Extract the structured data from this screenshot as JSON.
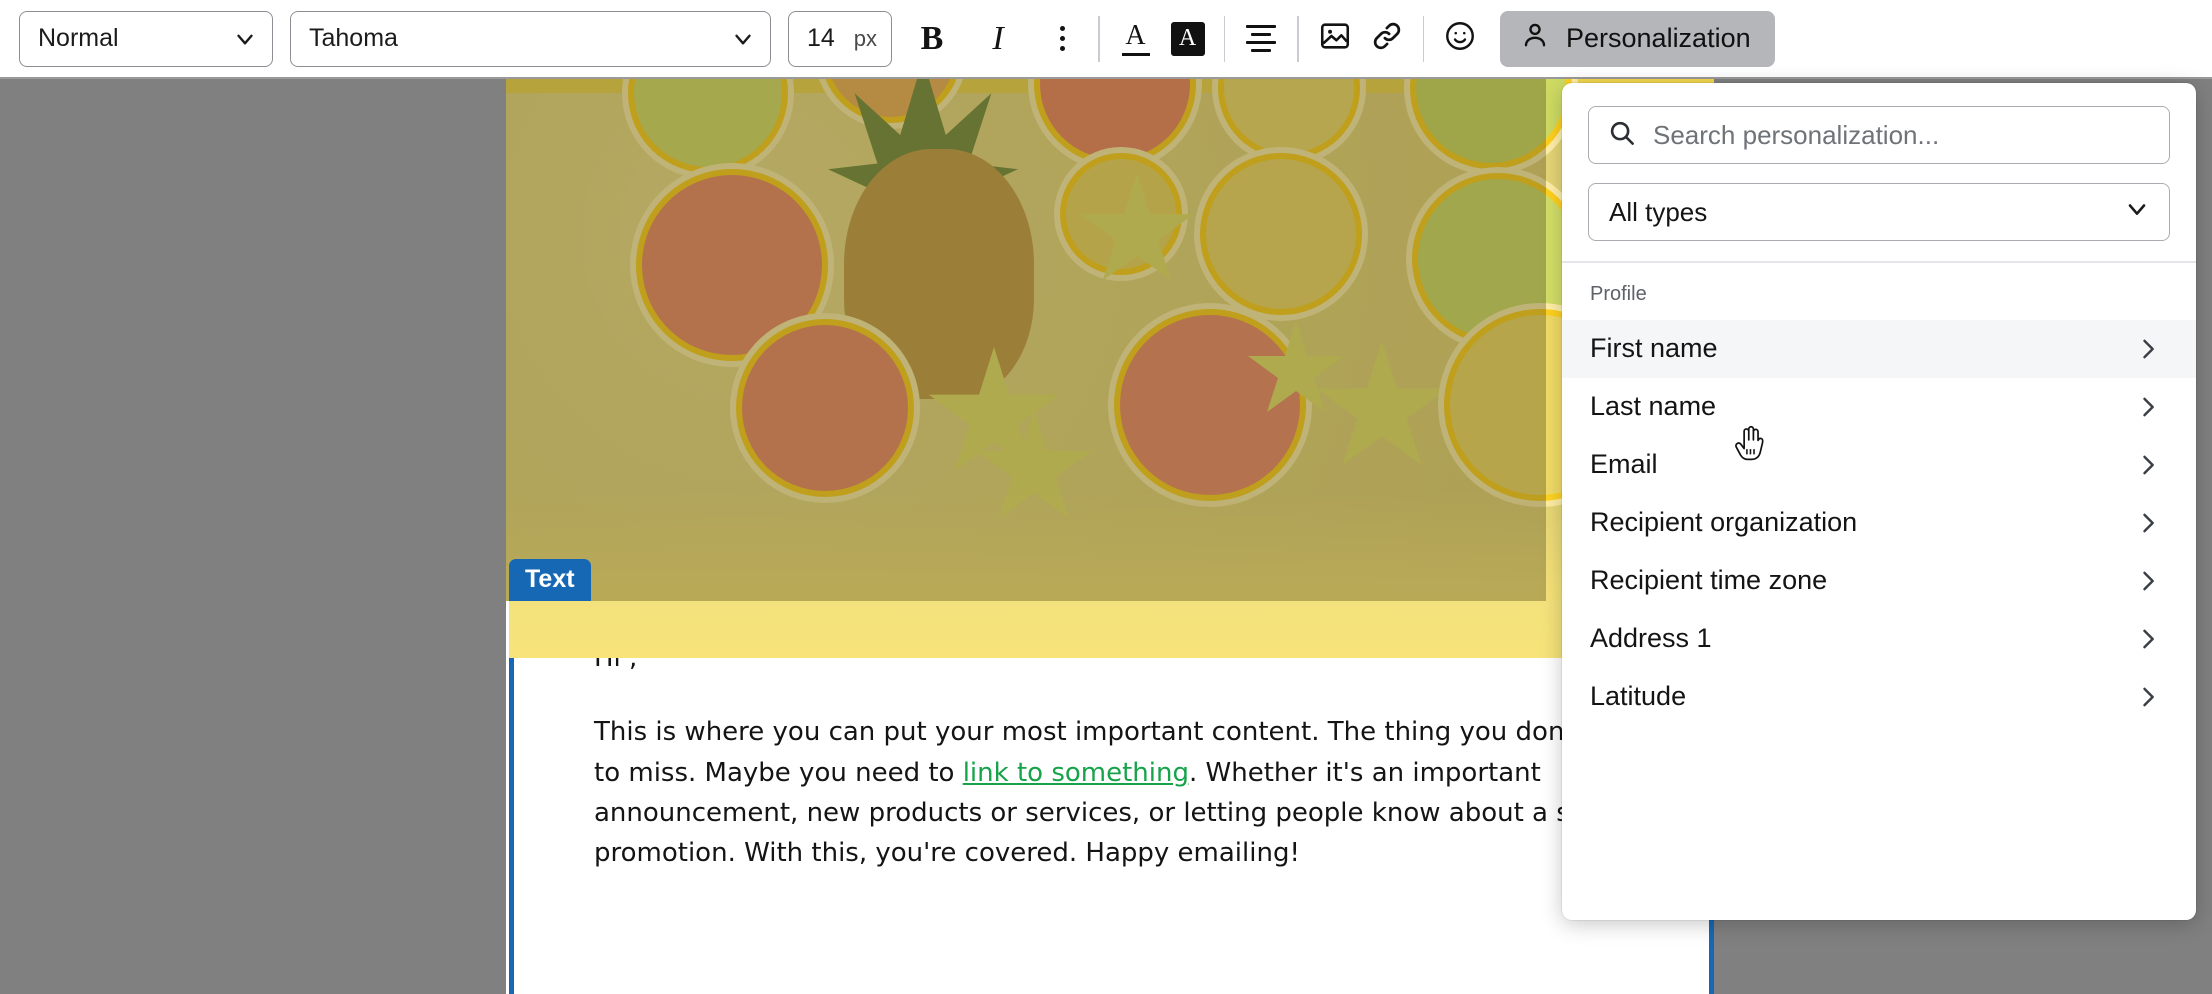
{
  "toolbar": {
    "style_select": {
      "value": "Normal",
      "icon": "chevron-down-icon"
    },
    "font_select": {
      "value": "Tahoma",
      "icon": "chevron-down-icon"
    },
    "font_size": {
      "value": "14",
      "unit": "px"
    },
    "bold_label": "B",
    "italic_label": "I",
    "more_label": "more-options",
    "font_color_label": "A",
    "highlight_label": "A",
    "align_label": "align",
    "image_label": "image",
    "link_label": "link",
    "emoji_label": "emoji",
    "personalization_label": "Personalization"
  },
  "email": {
    "hero_block_label": "hero-image",
    "text_badge": "Text",
    "greeting": "Hi ,",
    "paragraph_pre_link": "This is where you can put your most important content. The thing you don't want to miss. Maybe you need to ",
    "link_text": "link to something",
    "paragraph_post_link": ". Whether it's an important announcement, new products or services, or letting people know about a special promotion. With this, you're covered. Happy emailing!"
  },
  "panel": {
    "search": {
      "placeholder": "Search personalization...",
      "value": ""
    },
    "type_filter": {
      "value": "All types"
    },
    "group_label": "Profile",
    "items": [
      {
        "label": "First name",
        "active": true
      },
      {
        "label": "Last name",
        "active": false
      },
      {
        "label": "Email",
        "active": false
      },
      {
        "label": "Recipient organization",
        "active": false
      },
      {
        "label": "Recipient time zone",
        "active": false
      },
      {
        "label": "Address 1",
        "active": false
      },
      {
        "label": "Latitude",
        "active": false
      }
    ]
  },
  "colors": {
    "accent_blue": "#1668b4",
    "link_green": "#16a34a",
    "backdrop_gray": "#808080",
    "active_row": "#f4f6f8",
    "personalization_btn": "#b4b6b9"
  }
}
